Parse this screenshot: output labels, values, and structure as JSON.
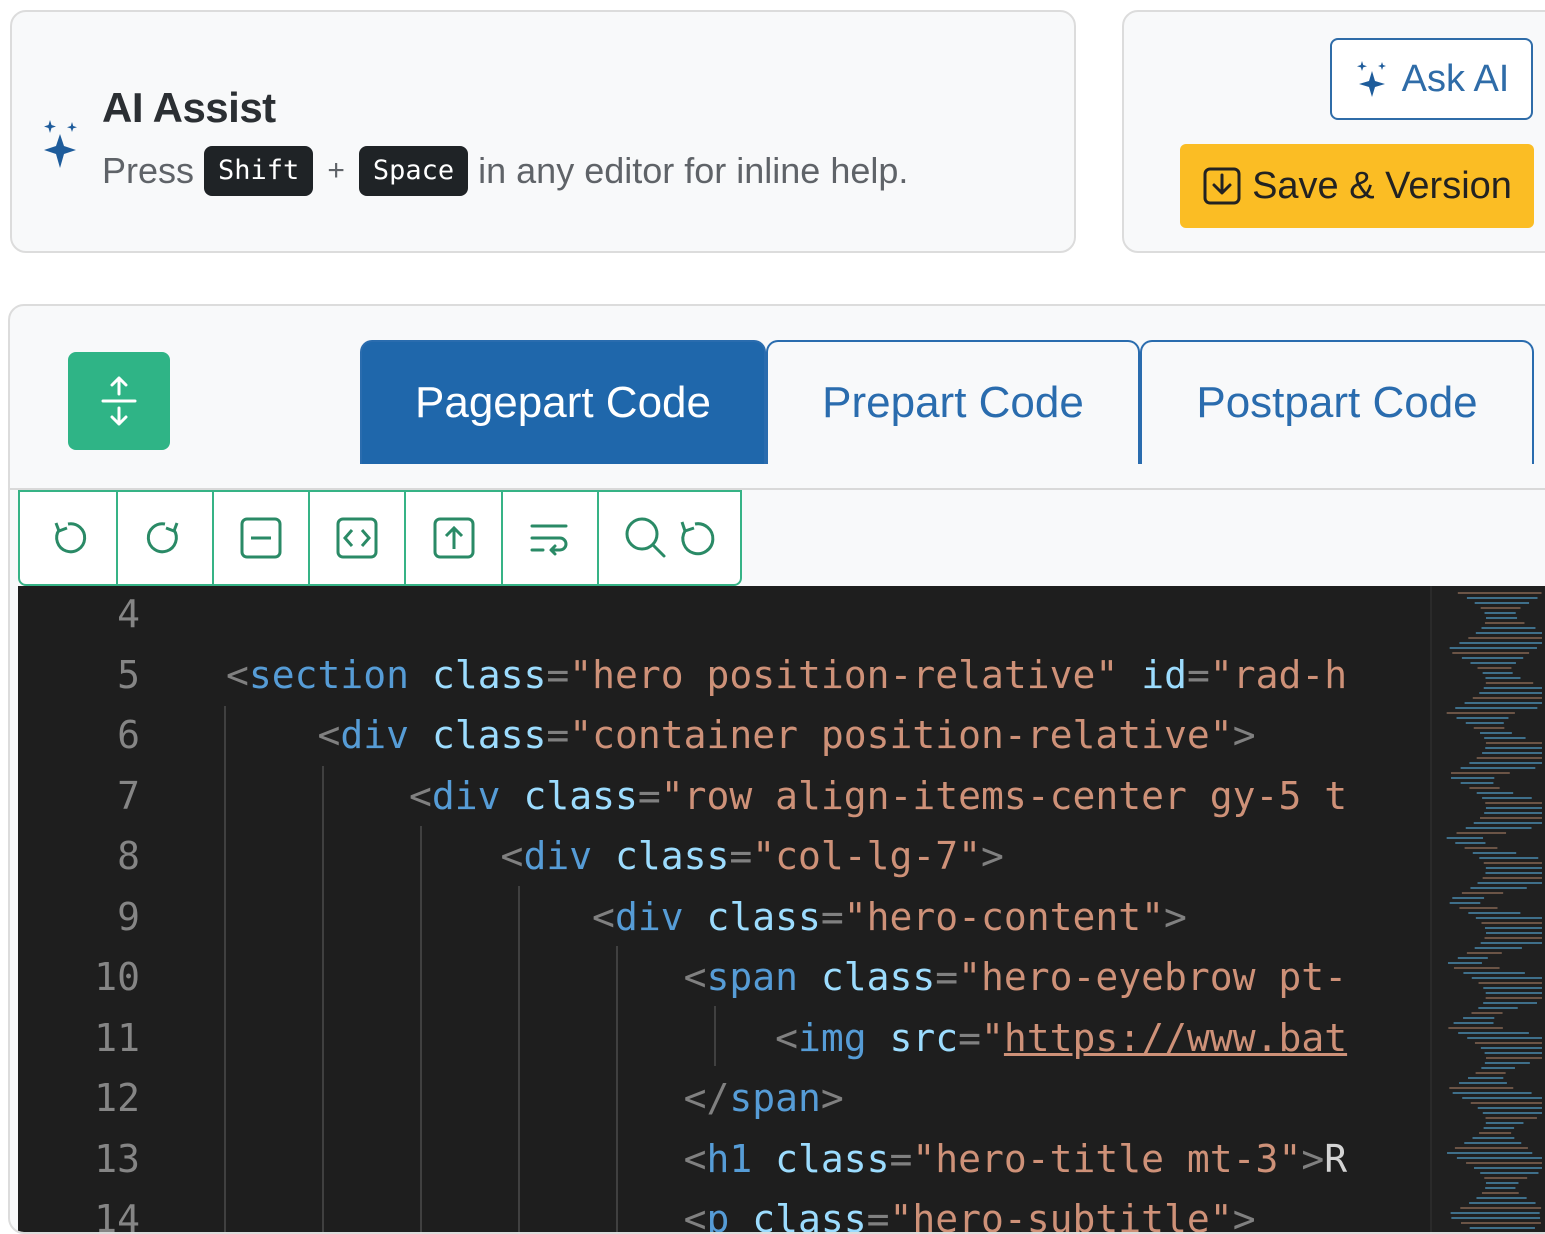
{
  "assist": {
    "icon": "sparkles-icon",
    "title": "AI Assist",
    "press": "Press",
    "key1": "Shift",
    "plus": "+",
    "key2": "Space",
    "suffix": "in any editor for inline help."
  },
  "actions": {
    "ask_ai": "Ask AI",
    "save_version": "Save & Version"
  },
  "tabs": [
    {
      "label": "Pagepart Code",
      "active": true
    },
    {
      "label": "Prepart Code",
      "active": false
    },
    {
      "label": "Postpart Code",
      "active": false
    }
  ],
  "toolbar": [
    "undo-icon",
    "redo-icon",
    "fold-icon",
    "code-icon",
    "upload-icon",
    "wrap-icon",
    "search-replace-icon"
  ],
  "editor": {
    "line_numbers": [
      "4",
      "5",
      "6",
      "7",
      "8",
      "9",
      "10",
      "11",
      "12",
      "13",
      "14"
    ],
    "lines": [
      "",
      "<section class=\"hero position-relative\" id=\"rad-h",
      "    <div class=\"container position-relative\">",
      "        <div class=\"row align-items-center gy-5 t",
      "            <div class=\"col-lg-7\">",
      "                <div class=\"hero-content\">",
      "                    <span class=\"hero-eyebrow pt-",
      "                        <img src=\"https://www.bat",
      "                    </span>",
      "                    <h1 class=\"hero-title mt-3\">R",
      "                    <p class=\"hero-subtitle\">"
    ]
  },
  "colors": {
    "primary": "#1f67ab",
    "accent": "#2fb486",
    "save": "#fbbd24"
  }
}
